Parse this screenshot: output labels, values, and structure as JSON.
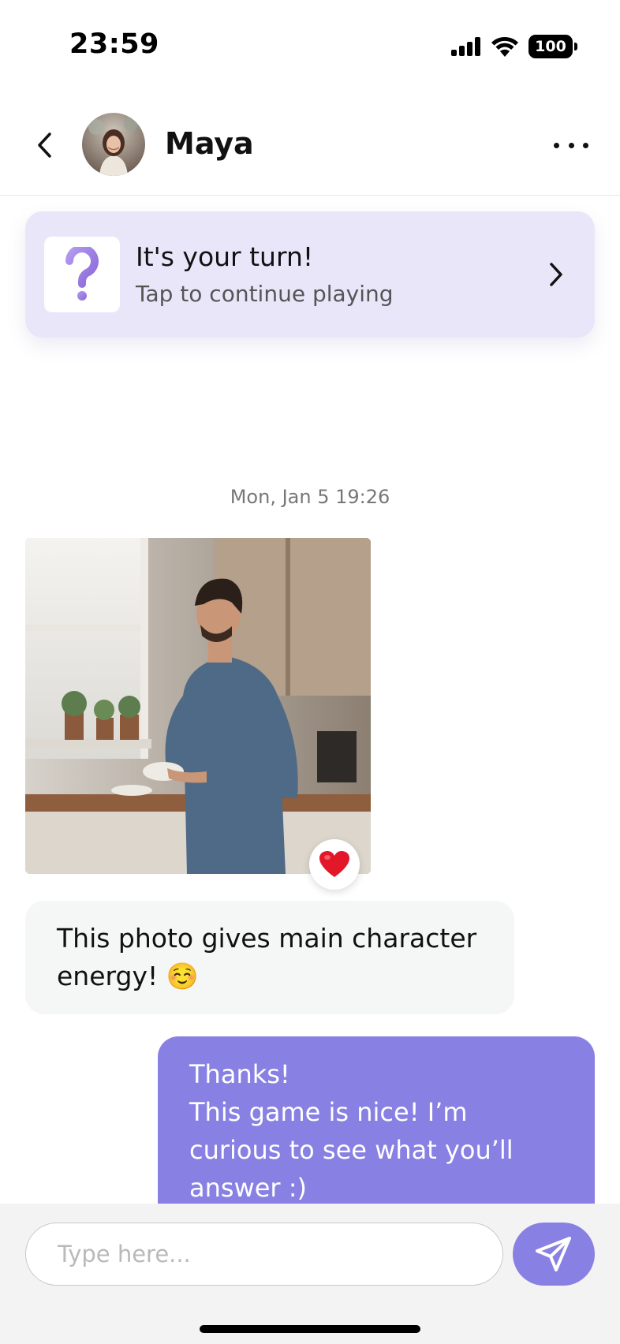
{
  "status_bar": {
    "time": "23:59",
    "battery": "100"
  },
  "header": {
    "contact_name": "Maya",
    "avatar_icon": "person-avatar",
    "back_icon": "chevron-left-icon",
    "more_icon": "ellipsis-icon"
  },
  "game_banner": {
    "title": "It's your turn!",
    "subtitle": "Tap to continue playing",
    "icon": "question-mark-icon",
    "accent": "#eae6fa"
  },
  "messages": {
    "date_stamp": "Mon, Jan 5 19:26",
    "photo_reaction": "❤️",
    "incoming_text": "This photo gives main character energy! ☺️",
    "outgoing_text": "Thanks!\nThis game is nice! I’m curious to see what you’ll answer :)"
  },
  "composer": {
    "placeholder": "Type here...",
    "send_icon": "paper-plane-icon"
  },
  "colors": {
    "brand": "#8880e3",
    "banner_bg": "#eae6fa"
  }
}
